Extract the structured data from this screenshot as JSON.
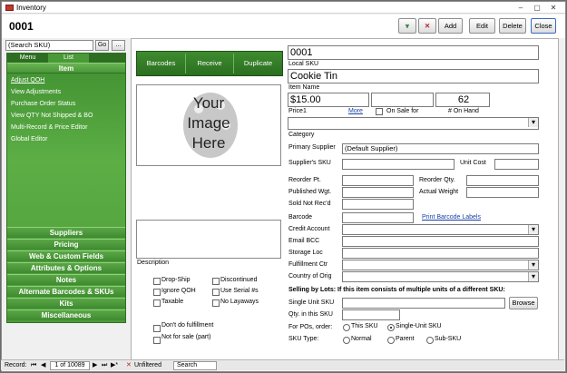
{
  "window": {
    "title": "Inventory",
    "min": "–",
    "max": "▢",
    "close": "✕"
  },
  "record": {
    "title": "0001"
  },
  "toolbar": {
    "filter_icon": "filter-icon",
    "clear_filter_icon": "clear-filter-icon",
    "add": "Add",
    "edit": "Edit",
    "delete": "Delete",
    "close": "Close"
  },
  "search": {
    "placeholder": "(Search SKU)",
    "go": "Go",
    "more": "..."
  },
  "nav": {
    "tabs": [
      "Menu",
      "List"
    ],
    "item_header": "Item",
    "items": [
      "Adjust QOH",
      "View Adjustments",
      "Purchase Order Status",
      "View QTY Not Shipped & BO",
      "Multi-Record & Price Editor",
      "Global Editor"
    ],
    "sections": [
      "Suppliers",
      "Pricing",
      "Web & Custom Fields",
      "Attributes & Options",
      "Notes",
      "Alternate Barcodes & SKUs",
      "Kits",
      "Miscellaneous"
    ]
  },
  "actions": {
    "barcodes": "Barcodes",
    "receive": "Receive",
    "duplicate": "Duplicate"
  },
  "image": {
    "line1": "Your",
    "line2": "Image",
    "line3": "Here"
  },
  "form": {
    "local_sku": "0001",
    "local_sku_label": "Local SKU",
    "item_name": "Cookie Tin",
    "item_name_label": "Item Name",
    "price1": "$15.00",
    "price1_label": "Price1",
    "more": "More",
    "on_sale_label": "On Sale for",
    "on_hand": "62",
    "on_hand_label": "# On Hand",
    "category_label": "Category",
    "primary_supplier_label": "Primary Supplier",
    "primary_supplier": "(Default Supplier)",
    "suppliers_sku_label": "Supplier's SKU",
    "unit_cost_label": "Unit Cost",
    "reorder_pt_label": "Reorder Pt.",
    "reorder_qty_label": "Reorder Qty.",
    "published_wgt_label": "Published Wgt.",
    "actual_weight_label": "Actual Weight",
    "sold_not_recd_label": "Sold Not Rec'd",
    "barcode_label": "Barcode",
    "print_barcode": "Print Barcode Labels",
    "credit_account_label": "Credit Account",
    "email_bcc_label": "Email BCC",
    "storage_loc_label": "Storage Loc",
    "fulfillment_ctr_label": "Fulfillment Ctr",
    "country_label": "Country of Orig",
    "lots_heading": "Selling by Lots: If this item consists of multiple units of a different SKU:",
    "single_unit_sku_label": "Single Unit SKU",
    "browse": "Browse",
    "qty_in_sku_label": "Qty. in this SKU",
    "for_pos_label": "For POs, order:",
    "this_sku": "This SKU",
    "single_unit_sku_opt": "Single-Unit SKU",
    "sku_type_label": "SKU Type:",
    "normal": "Normal",
    "parent": "Parent",
    "sub_sku": "Sub-SKU",
    "description_label": "Description"
  },
  "checks": {
    "drop_ship": "Drop-Ship",
    "discontinued": "Discontinued",
    "ignore_qoh": "Ignore QOH",
    "use_serial": "Use Serial #s",
    "taxable": "Taxable",
    "no_layaways": "No Layaways",
    "dont_fulfill": "Don't do fulfillment",
    "not_for_sale": "Not for sale (part)"
  },
  "status": {
    "record_label": "Record:",
    "position": "1 of 10089",
    "unfiltered": "Unfiltered",
    "search": "Search"
  }
}
